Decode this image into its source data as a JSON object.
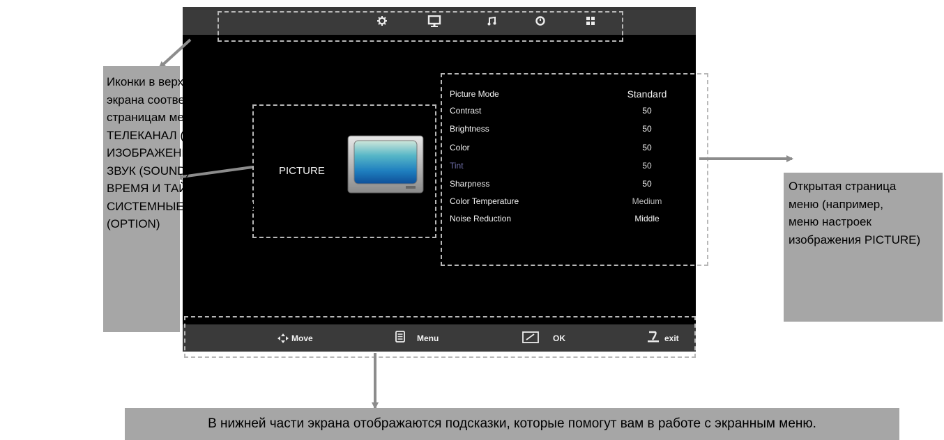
{
  "tv": {
    "top_icons": [
      "gear-icon",
      "monitor-icon",
      "music-note-icon",
      "clock-icon",
      "grid-icon"
    ],
    "page_label": "PICTURE",
    "menu_items": [
      {
        "label": "Picture Mode",
        "value": "Standard"
      },
      {
        "label": "Contrast",
        "value": "50"
      },
      {
        "label": "Brightness",
        "value": "50"
      },
      {
        "label": "Color",
        "value": "50"
      },
      {
        "label": "Tint",
        "value": "50"
      },
      {
        "label": "Sharpness",
        "value": "50"
      },
      {
        "label": "Color Temperature",
        "value": "Medium"
      },
      {
        "label": "Noise Reduction",
        "value": "Middle"
      }
    ],
    "hints": {
      "move": "Move",
      "menu": "Menu",
      "ok": "OK",
      "exit": "exit"
    }
  },
  "notes": {
    "left": [
      "Иконки в верхней части",
      "экрана соответствуют",
      "страницам меню:",
      "ТЕЛЕКАНАЛ (CHANNEL),",
      "ИЗОБРАЖЕНИЕ (PICTURE)",
      "ЗВУК (SOUND)",
      "ВРЕМЯ И ТАЙМЕР (TIME)",
      "СИСТЕМНЫЕ НАСТРОЙКИ",
      "(OPTION)"
    ],
    "right": [
      "Открытая страница",
      "меню (например,",
      "меню настроек",
      "изображения PICTURE)"
    ],
    "bottom": "В нижней части экрана отображаются подсказки, которые помогут вам в работе с экранным меню."
  },
  "colors": {
    "screen": "#000000",
    "bars": "#3a3a3a",
    "note_bg": "#a6a6a6",
    "arrow": "#8c8c8c",
    "tint_label": "#6e6ea8"
  }
}
